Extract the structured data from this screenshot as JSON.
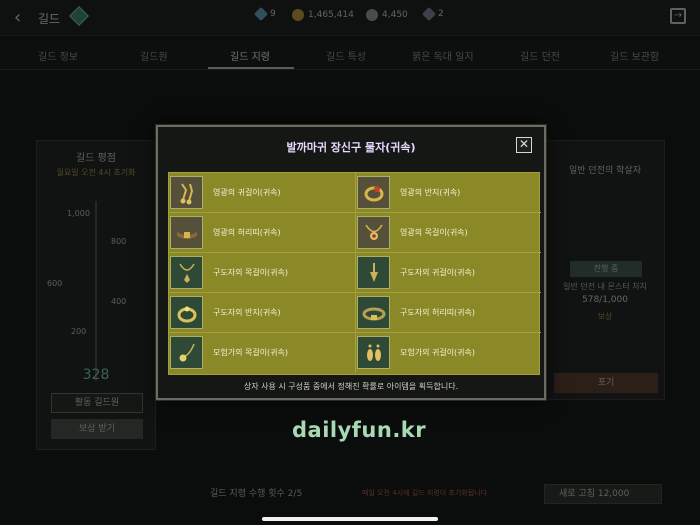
{
  "topbar": {
    "title": "길드",
    "currencies": [
      {
        "icon": "gem-icon",
        "value": "9",
        "color": "#6aa8c8"
      },
      {
        "icon": "gold-coin-icon",
        "value": "1,465,414",
        "color": "#c9a23a"
      },
      {
        "icon": "silver-coin-icon",
        "value": "4,450",
        "color": "#9aa4a8"
      },
      {
        "icon": "crystal-icon",
        "value": "2",
        "color": "#7b8aa0"
      }
    ]
  },
  "tabs": [
    "길드 정보",
    "길드원",
    "길드 지령",
    "길드 특성",
    "붉은 독대 일지",
    "길드 던전",
    "길드 보관함"
  ],
  "rank_panel": {
    "title": "길드 평점",
    "subtitle": "월요일 오전 4시 초기화",
    "ticks": [
      "1,000",
      "800",
      "600",
      "400",
      "200"
    ],
    "score": "328",
    "member_button": "활동 길드원",
    "second_button": "보상 받기"
  },
  "dungeon_panel": {
    "title": "일반 던전의 학살자",
    "status": "진행 중",
    "desc": "일반 던전 내 몬스터 처치",
    "progress": "578/1,000",
    "reward_label": "보상",
    "button": "포기"
  },
  "bottom": {
    "info": "길드 지령 수행 횟수 2/5",
    "warning": "매일 오전 4시에 길드 지령이 초기화됩니다",
    "button": "새로 고침  12,000"
  },
  "modal": {
    "title": "발까마귀 장신구 물자(귀속)",
    "footer": "상자 사용 시 구성품 중에서 정해진 확률로 아이템을 획득합니다.",
    "items": [
      {
        "name": "영광의 귀걸이(귀속)",
        "icon": "earring-icon"
      },
      {
        "name": "영광의 반지(귀속)",
        "icon": "ring-icon"
      },
      {
        "name": "영광의 허리띠(귀속)",
        "icon": "belt-icon"
      },
      {
        "name": "영광의 목걸이(귀속)",
        "icon": "necklace-icon"
      },
      {
        "name": "구도자의 목걸이(귀속)",
        "icon": "necklace-icon"
      },
      {
        "name": "구도자의 귀걸이(귀속)",
        "icon": "earring-icon"
      },
      {
        "name": "구도자의 반지(귀속)",
        "icon": "ring-icon"
      },
      {
        "name": "구도자의 허리띠(귀속)",
        "icon": "belt-icon"
      },
      {
        "name": "모험가의 목걸이(귀속)",
        "icon": "necklace-icon"
      },
      {
        "name": "모험가의 귀걸이(귀속)",
        "icon": "earring-icon"
      }
    ]
  },
  "watermark": "dailyfun.kr"
}
